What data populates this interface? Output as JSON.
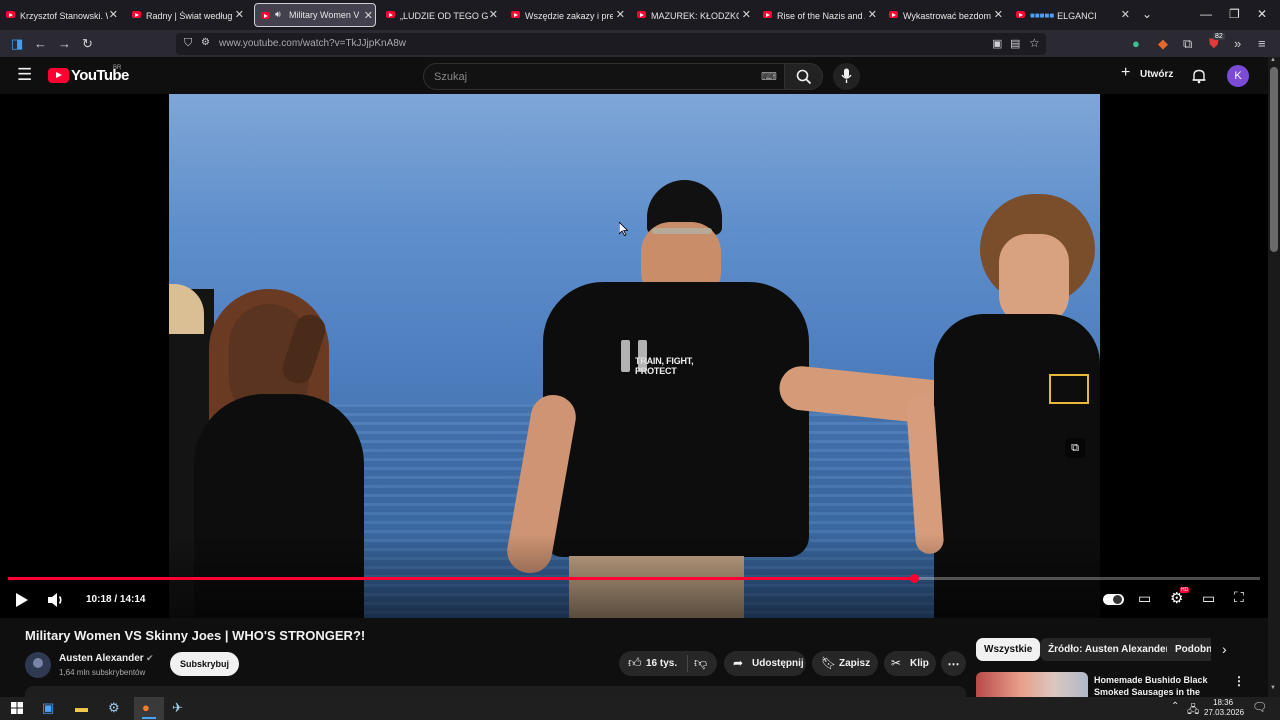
{
  "browser": {
    "tabs": [
      {
        "title": "Krzysztof Stanowski. W ja"
      },
      {
        "title": "Radny | Świat według Kie"
      },
      {
        "title": "Military Women VS S"
      },
      {
        "title": "„LUDZIE OD TEGO GŁUPI"
      },
      {
        "title": "Wszędzie zakazy i preten"
      },
      {
        "title": "MAZUREK: KŁODZKO, PE"
      },
      {
        "title": "Rise of the Nazis and Ad"
      },
      {
        "title": "Wykastrować bezdomno"
      },
      {
        "title": "ELGANCI"
      }
    ],
    "url": "www.youtube.com/watch?v=TkJJjpKnA8w",
    "badge_count": "82"
  },
  "youtube": {
    "logo_text": "YouTube",
    "region": "BR",
    "search_placeholder": "Szukaj",
    "create_label": "Utwórz",
    "avatar_letter": "K"
  },
  "player": {
    "time_current": "10:18",
    "time_total": "14:14",
    "time_display": "10:18 / 14:14",
    "progress_fraction": 0.724,
    "shirt_text": "TRAIN, FIGHT, PROTECT",
    "accent_color": "#ff0033"
  },
  "video": {
    "title": "Military Women VS Skinny Joes | WHO'S STRONGER?!",
    "channel": "Austen Alexander",
    "subscribers": "1,64 mln subskrybentów",
    "subscribe_label": "Subskrybuj",
    "likes": "16 tys.",
    "share_label": "Udostępnij",
    "save_label": "Zapisz",
    "clip_label": "Klip"
  },
  "sidebar": {
    "chips": [
      "Wszystkie",
      "Źródło: Austen Alexander",
      "Podobne"
    ],
    "rec_title": "Homemade Bushido Black Smoked Sausages in the"
  },
  "taskbar": {
    "time": "18:36",
    "date": "27.03.2026"
  }
}
